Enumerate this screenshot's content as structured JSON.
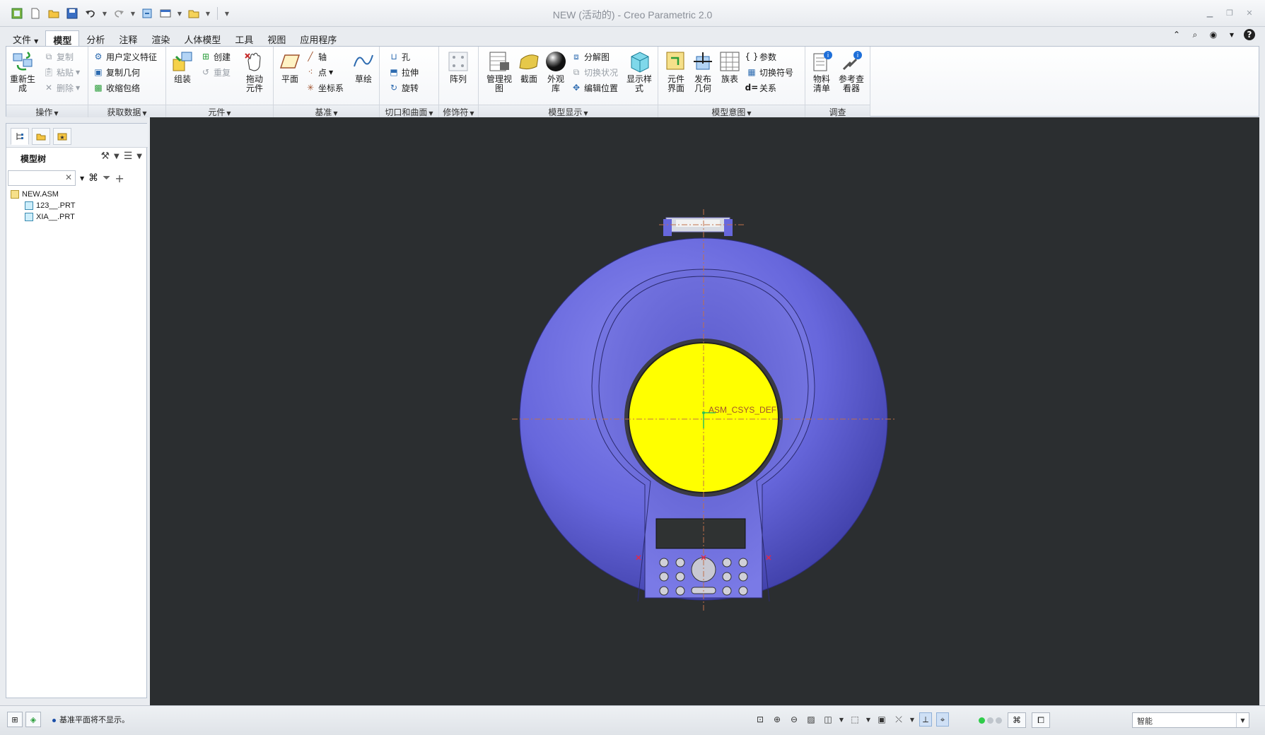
{
  "window": {
    "title": "NEW (活动的) - Creo Parametric 2.0"
  },
  "tabs": [
    "文件",
    "模型",
    "分析",
    "注释",
    "渲染",
    "人体模型",
    "工具",
    "视图",
    "应用程序"
  ],
  "ribbon": {
    "operations": {
      "label": "操作",
      "regenerate": "重新生成",
      "copy": "复制",
      "paste": "粘贴",
      "delete": "删除"
    },
    "get_data": {
      "label": "获取数据",
      "udf": "用户定义特征",
      "copy_geometry": "复制几何",
      "shrinkwrap": "收缩包络"
    },
    "component": {
      "label": "元件",
      "assemble": "组装",
      "create": "创建",
      "repeat": "重复",
      "drag": "拖动元件"
    },
    "datum": {
      "label": "基准",
      "plane": "平面",
      "axis": "轴",
      "point": "点",
      "csys": "坐标系",
      "sketch": "草绘"
    },
    "cut_surface": {
      "label": "切口和曲面",
      "hole": "孔",
      "extrude": "拉伸",
      "revolve": "旋转"
    },
    "modifiers": {
      "label": "修饰符",
      "pattern": "阵列"
    },
    "model_display": {
      "label": "模型显示",
      "manage_views": "管理视图",
      "section": "截面",
      "appearance": "外观库",
      "explode": "分解图",
      "toggle_status": "切换状况",
      "edit_position": "编辑位置",
      "display_style": "显示样式"
    },
    "model_intent": {
      "label": "模型意图",
      "component_interface": "元件界面",
      "publish_geometry": "发布几何",
      "family_table": "族表",
      "parameters": "参数",
      "switch_symbols": "切换符号",
      "relations": "关系"
    },
    "investigate": {
      "label": "调查",
      "bom": "物料清单",
      "ref_viewer": "参考查看器"
    }
  },
  "left_panel": {
    "tree_title": "模型树",
    "search_placeholder": "",
    "items": [
      {
        "name": "NEW.ASM"
      },
      {
        "name": "123__.PRT"
      },
      {
        "name": "XIA__.PRT"
      }
    ]
  },
  "viewport": {
    "csys_label": "ASM_CSYS_DEF",
    "background": "#2b2e30",
    "body_color": "#6f6fe0",
    "speaker_color": "#ffff00"
  },
  "status": {
    "message": "基准平面将不显示。",
    "selection_filter": "智能"
  }
}
